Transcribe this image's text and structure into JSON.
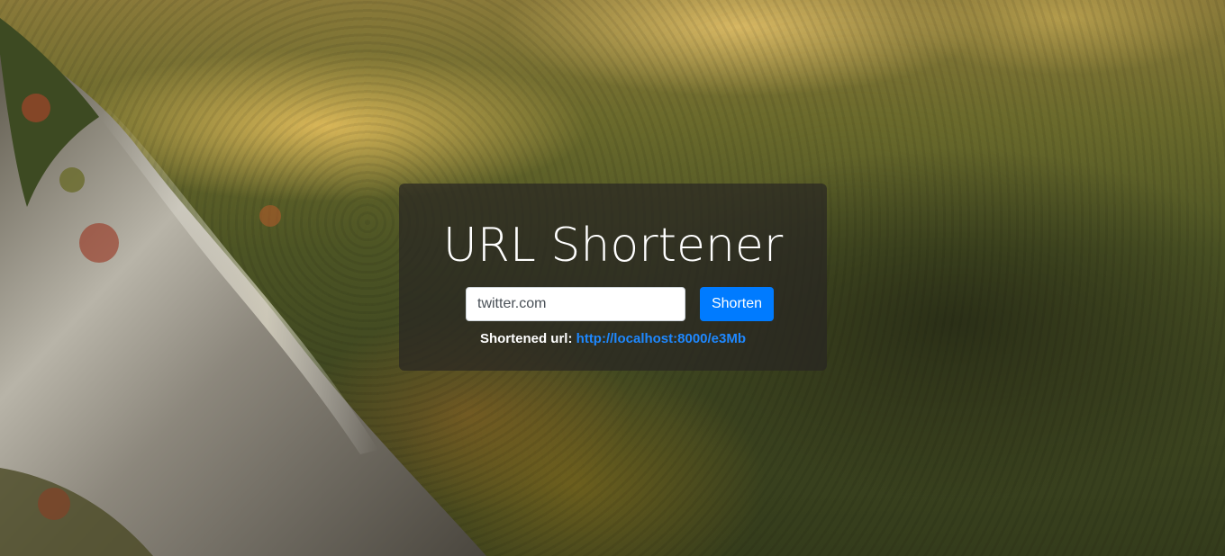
{
  "app": {
    "title": "URL Shortener"
  },
  "form": {
    "url_value": "twitter.com",
    "submit_label": "Shorten"
  },
  "result": {
    "label": "Shortened url:",
    "link_text": "http://localhost:8000/e3Mb"
  },
  "colors": {
    "primary": "#007bff",
    "link": "#1e88ff",
    "card_background": "rgba(40,38,34,0.72)",
    "title_text": "#ffffff"
  }
}
